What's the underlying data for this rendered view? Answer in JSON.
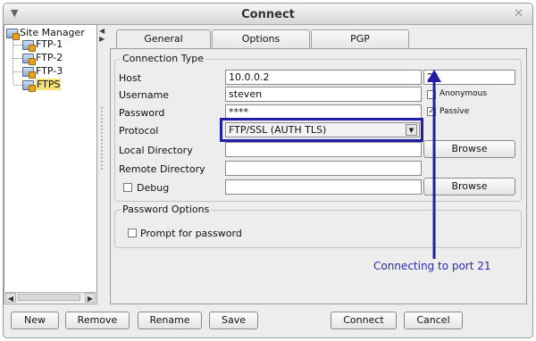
{
  "window": {
    "title": "Connect"
  },
  "site_tree": {
    "root": "Site Manager",
    "items": [
      "FTP-1",
      "FTP-2",
      "FTP-3",
      "FTPS"
    ],
    "selected": "FTPS"
  },
  "tabs": [
    {
      "label": "General",
      "active": true
    },
    {
      "label": "Options",
      "active": false
    },
    {
      "label": "PGP",
      "active": false
    }
  ],
  "connection": {
    "group_title": "Connection Type",
    "host_label": "Host",
    "host_value": "10.0.0.2",
    "port_value": "21",
    "username_label": "Username",
    "username_value": "steven",
    "anonymous_label": "Anonymous",
    "anonymous_checked": false,
    "password_label": "Password",
    "password_value": "****",
    "passive_label": "Passive",
    "passive_checked": true,
    "protocol_label": "Protocol",
    "protocol_value": "FTP/SSL (AUTH TLS)",
    "local_dir_label": "Local Directory",
    "local_dir_value": "",
    "remote_dir_label": "Remote Directory",
    "remote_dir_value": "",
    "debug_label": "Debug",
    "debug_checked": false,
    "debug_value": "",
    "browse_label": "Browse"
  },
  "password_options": {
    "group_title": "Password Options",
    "prompt_label": "Prompt for password",
    "prompt_checked": false
  },
  "annotation": {
    "text": "Connecting to port 21",
    "color": "#2a2ab4"
  },
  "buttons": {
    "new": "New",
    "remove": "Remove",
    "rename": "Rename",
    "save": "Save",
    "connect": "Connect",
    "cancel": "Cancel"
  },
  "icons": {
    "menu": "chevron-down-icon",
    "close": "close-icon",
    "site_node": "computer-node-icon",
    "dropdown": "dropdown-arrow-icon"
  }
}
